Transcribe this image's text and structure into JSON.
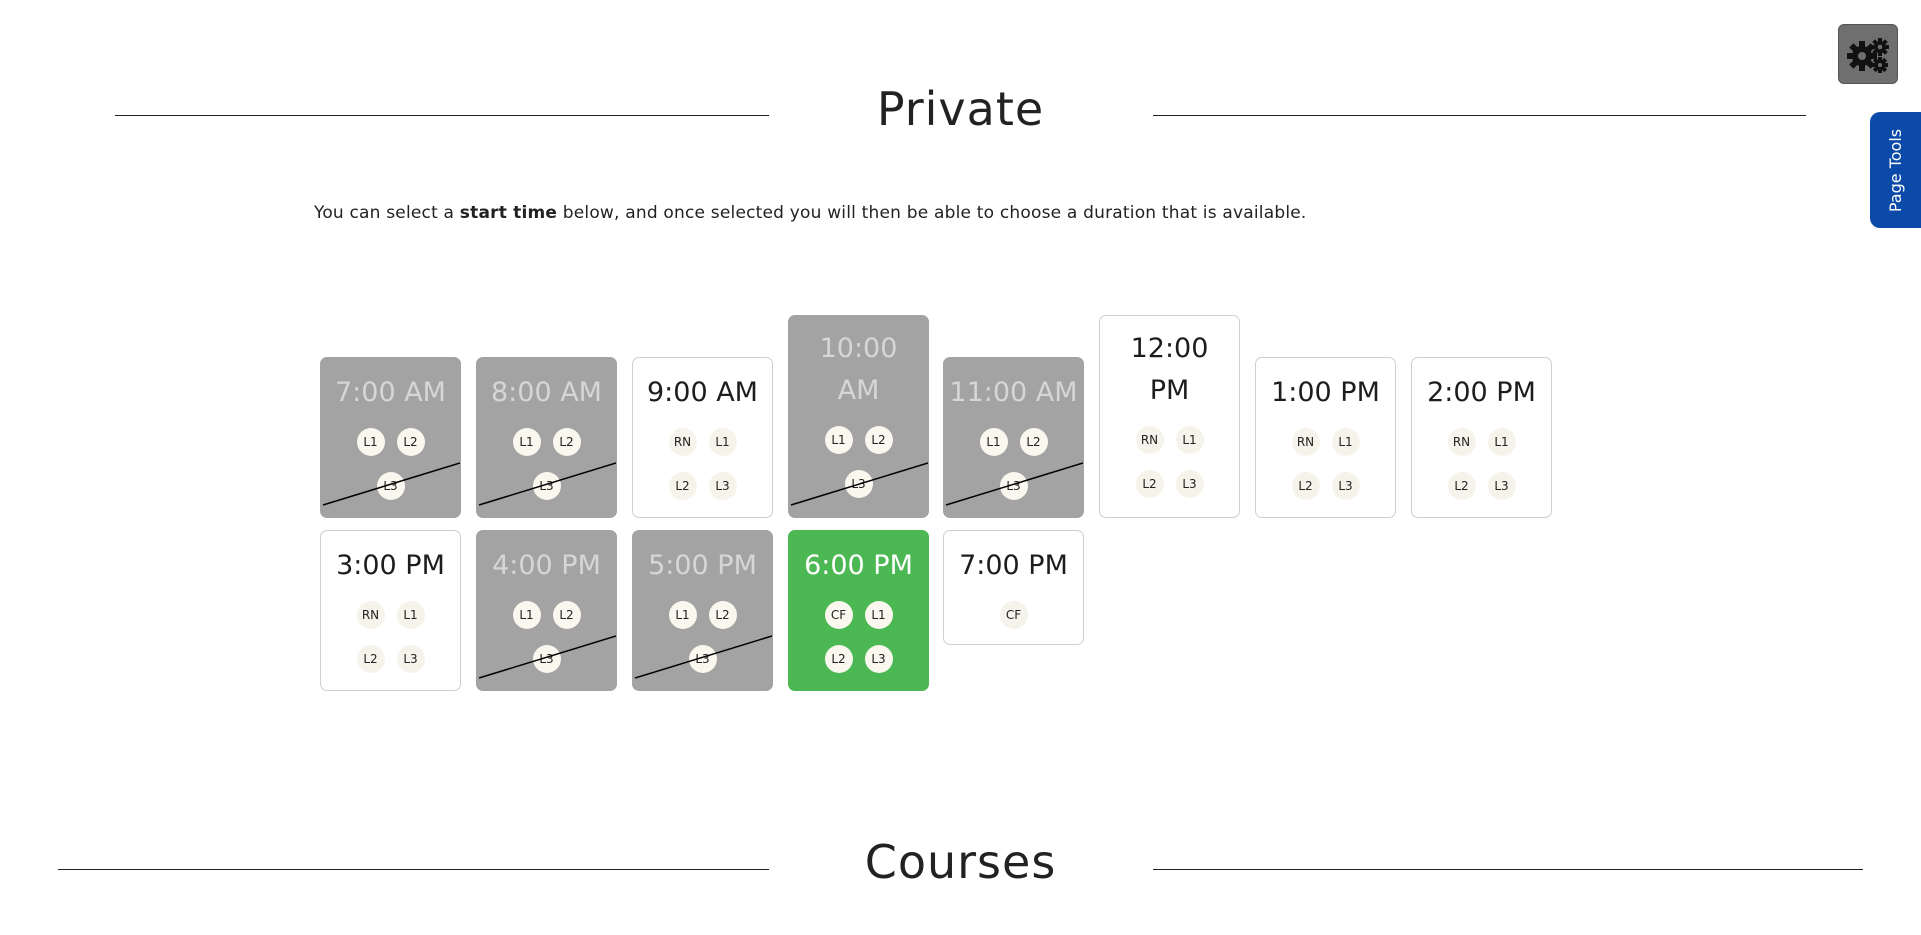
{
  "sections": {
    "private_title": "Private",
    "courses_title": "Courses"
  },
  "intro": {
    "prefix": "You can select a ",
    "bold": "start time",
    "suffix": " below, and once selected you will then be able to choose a duration that is available."
  },
  "slots": [
    {
      "time": "7:00 AM",
      "state": "unavailable",
      "badges": [
        "L1",
        "L2",
        "L3"
      ]
    },
    {
      "time": "8:00 AM",
      "state": "unavailable",
      "badges": [
        "L1",
        "L2",
        "L3"
      ]
    },
    {
      "time": "9:00 AM",
      "state": "available",
      "badges": [
        "RN",
        "L1",
        "L2",
        "L3"
      ]
    },
    {
      "time_line1": "10:00",
      "time_line2": "AM",
      "state": "unavailable",
      "badges": [
        "L1",
        "L2",
        "L3"
      ]
    },
    {
      "time": "11:00 AM",
      "state": "unavailable",
      "badges": [
        "L1",
        "L2",
        "L3"
      ]
    },
    {
      "time_line1": "12:00",
      "time_line2": "PM",
      "state": "available",
      "badges": [
        "RN",
        "L1",
        "L2",
        "L3"
      ]
    },
    {
      "time": "1:00 PM",
      "state": "available",
      "badges": [
        "RN",
        "L1",
        "L2",
        "L3"
      ]
    },
    {
      "time": "2:00 PM",
      "state": "available",
      "badges": [
        "RN",
        "L1",
        "L2",
        "L3"
      ]
    },
    {
      "time": "3:00 PM",
      "state": "available",
      "badges": [
        "RN",
        "L1",
        "L2",
        "L3"
      ]
    },
    {
      "time": "4:00 PM",
      "state": "unavailable",
      "badges": [
        "L1",
        "L2",
        "L3"
      ]
    },
    {
      "time": "5:00 PM",
      "state": "unavailable",
      "badges": [
        "L1",
        "L2",
        "L3"
      ]
    },
    {
      "time": "6:00 PM",
      "state": "selected",
      "badges": [
        "CF",
        "L1",
        "L2",
        "L3"
      ]
    },
    {
      "time": "7:00 PM",
      "state": "available",
      "badges": [
        "CF"
      ]
    }
  ],
  "tools": {
    "gear_icon": "gears-icon",
    "page_tools_label": "Page Tools"
  },
  "colors": {
    "unavailable": "#a3a3a3",
    "selected": "#4cb853",
    "page_tools": "#0b4aa8"
  }
}
